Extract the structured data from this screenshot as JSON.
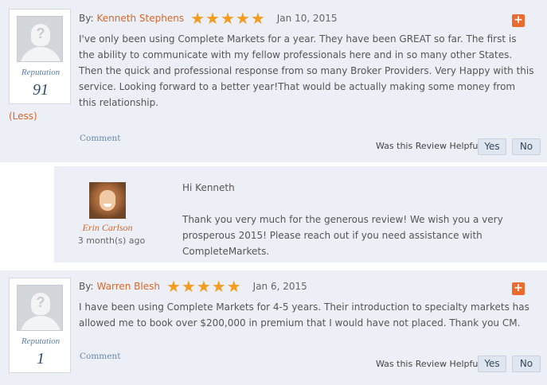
{
  "reviews": [
    {
      "by_label": "By:",
      "author": "Kenneth Stephens",
      "stars": 5,
      "date": "Jan 10, 2015",
      "text": "I've only been using Complete Markets for a year. They have been GREAT so far. The first is the ability to communicate with my fellow professionals here and in so many other States. Then the quick and professional response from so many Broker Providers. Very Happy with this service. Looking forward to a better year!That would be actually making some money from this relationship.",
      "reputation_label": "Reputation",
      "reputation_value": "91",
      "less_link": "(Less)",
      "comment_link": "Comment",
      "helpful_label": "Was this Review Helpful?",
      "yes_label": "Yes",
      "no_label": "No",
      "expand_icon": "plus-icon"
    },
    {
      "by_label": "By:",
      "author": "Warren Blesh",
      "stars": 5,
      "date": "Jan 6, 2015",
      "text": "I have been using Complete Markets for 4-5 years. Their introduction to specialty markets has allowed me to book over $200,000 in premium that I would have not placed. Thank you CM.",
      "reputation_label": "Reputation",
      "reputation_value": "1",
      "comment_link": "Comment",
      "helpful_label": "Was this Review Helpful?",
      "yes_label": "Yes",
      "no_label": "No",
      "expand_icon": "plus-icon"
    }
  ],
  "reply": {
    "name": "Erin Carlson",
    "time": "3 month(s) ago",
    "greeting": "Hi Kenneth",
    "text": "Thank you very much for the generous review! We wish you a very prosperous 2015! Please reach out if you need assistance with CompleteMarkets."
  },
  "colors": {
    "accent_orange": "#d9672b",
    "star": "#f39c1e",
    "panel_bg": "#eceff6",
    "link_blue": "#6a8aa8"
  }
}
